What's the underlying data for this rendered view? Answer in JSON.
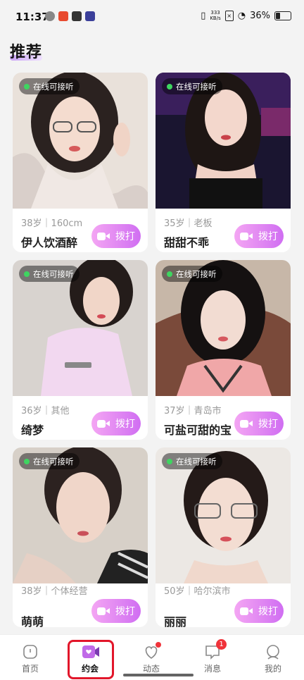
{
  "status_bar": {
    "time": "11:37",
    "speed_value": "333",
    "speed_unit": "KB/s",
    "battery": "36%"
  },
  "page": {
    "title": "推荐"
  },
  "cards": [
    {
      "online": "在线可接听",
      "meta": "38岁｜160cm",
      "name": "伊人饮酒醉",
      "call": "拨打"
    },
    {
      "online": "在线可接听",
      "meta": "35岁｜老板",
      "name": "甜甜不乖",
      "call": "拨打"
    },
    {
      "online": "在线可接听",
      "meta": "36岁｜其他",
      "name": "绮梦",
      "call": "拨打"
    },
    {
      "online": "在线可接听",
      "meta": "37岁｜青岛市",
      "name": "可盐可甜的宝",
      "call": "拨打"
    },
    {
      "online": "在线可接听",
      "meta": "38岁｜个体经营",
      "name": "萌萌",
      "call": "拨打"
    },
    {
      "online": "在线可接听",
      "meta": "50岁｜哈尔滨市",
      "name": "丽丽",
      "call": "拨打"
    }
  ],
  "nav": {
    "home": "首页",
    "dating": "约会",
    "moments": "动态",
    "messages": "消息",
    "messages_badge": "1",
    "mine": "我的"
  },
  "colors": {
    "accent": "#d06ef2",
    "online_dot": "#3ed560",
    "badge": "#f0333a",
    "highlight_box": "#e2162a"
  }
}
